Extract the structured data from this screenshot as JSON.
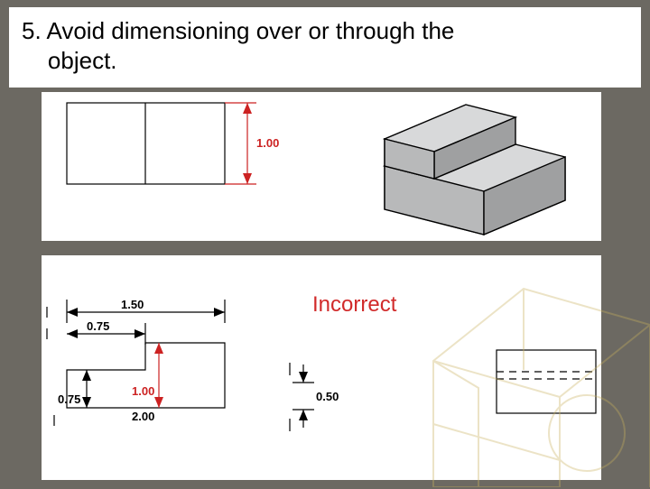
{
  "heading": {
    "line1": "5. Avoid dimensioning over or through the",
    "line2": "object."
  },
  "labels": {
    "incorrect": "Incorrect"
  },
  "dimensions": {
    "top_height": "1.00",
    "front_width_long": "1.50",
    "front_width_short": "0.75",
    "front_h_short": "0.75",
    "front_h_red": "1.00",
    "front_depth": "2.00",
    "side_h": "0.50"
  }
}
